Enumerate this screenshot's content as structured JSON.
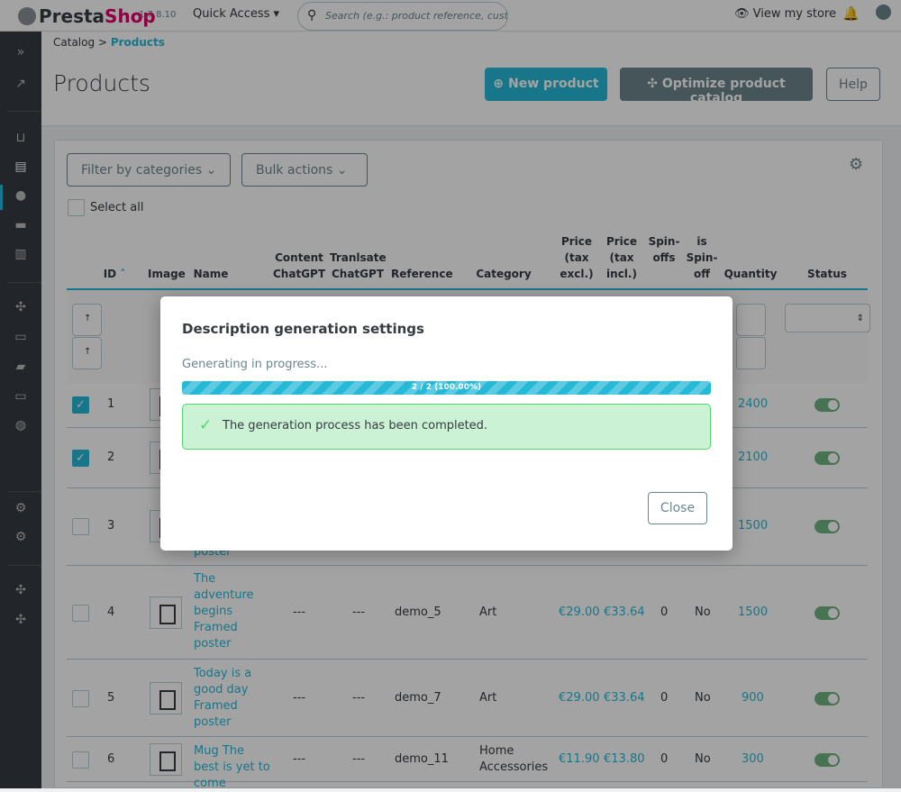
{
  "topbar": {
    "brand_a": "Presta",
    "brand_b": "Shop",
    "version": "1.7.8.10",
    "quick_access": "Quick Access ▾",
    "search_placeholder": "Search (e.g.: product reference, custon",
    "view_store": "View my store"
  },
  "breadcrumb": {
    "parent": "Catalog",
    "sep": ">",
    "current": "Products"
  },
  "header": {
    "title": "Products",
    "new_product": "New product",
    "optimize": "Optimize product catalog",
    "help": "Help"
  },
  "toolbar": {
    "filter_categories": "Filter by categories",
    "bulk_actions": "Bulk actions",
    "select_all": "Select all"
  },
  "columns": [
    "ID",
    "Image",
    "Name",
    "Content ChatGPT",
    "Tranlsate ChatGPT",
    "Reference",
    "Category",
    "Price (tax excl.)",
    "Price (tax incl.)",
    "Spin-offs",
    "is Spin-off",
    "Quantity",
    "Status"
  ],
  "rows": [
    {
      "id": "1",
      "checked": true,
      "quantity": "2400",
      "status": true
    },
    {
      "id": "2",
      "checked": true,
      "quantity": "2100",
      "status": true
    },
    {
      "id": "3",
      "checked": false,
      "name": "poster",
      "quantity": "1500",
      "status": true
    },
    {
      "id": "4",
      "checked": false,
      "name": "The adventure begins Framed poster",
      "content": "---",
      "translate": "---",
      "reference": "demo_5",
      "category": "Art",
      "price_excl": "€29.00",
      "price_incl": "€33.64",
      "spinoffs": "0",
      "is_spinoff": "No",
      "quantity": "1500",
      "status": true
    },
    {
      "id": "5",
      "checked": false,
      "name": "Today is a good day Framed poster",
      "content": "---",
      "translate": "---",
      "reference": "demo_7",
      "category": "Art",
      "price_excl": "€29.00",
      "price_incl": "€33.64",
      "spinoffs": "0",
      "is_spinoff": "No",
      "quantity": "900",
      "status": true
    },
    {
      "id": "6",
      "checked": false,
      "name": "Mug The best is yet to come",
      "content": "---",
      "translate": "---",
      "reference": "demo_11",
      "category": "Home Accessories",
      "price_excl": "€11.90",
      "price_incl": "€13.80",
      "spinoffs": "0",
      "is_spinoff": "No",
      "quantity": "300",
      "status": true
    }
  ],
  "modal": {
    "title": "Description generation settings",
    "status": "Generating in progress...",
    "progress_label": "2 / 2 (100.00%)",
    "progress_percent": 100,
    "success_message": "The generation process has been completed.",
    "close": "Close"
  },
  "colors": {
    "accent": "#25b9d7",
    "success": "#53d572",
    "sidebar": "#363a41"
  }
}
